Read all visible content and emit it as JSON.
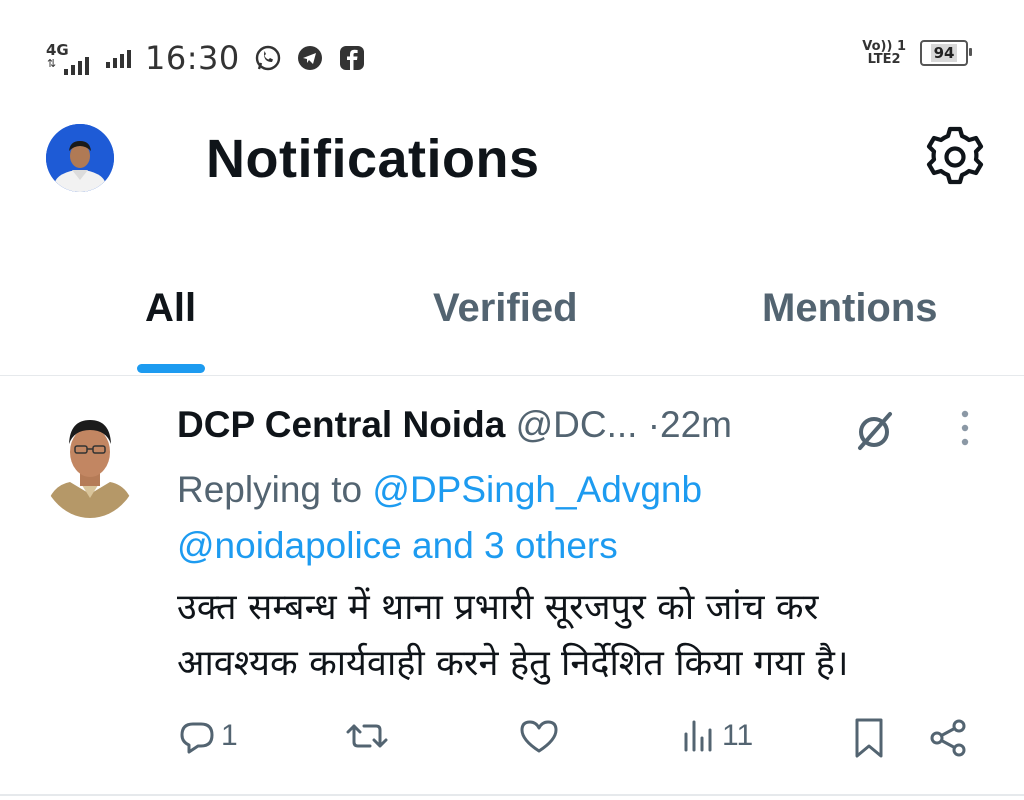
{
  "status_bar": {
    "network_type": "4G",
    "time": "16:30",
    "volte_line1": "Vo)) 1",
    "volte_line2": "LTE2",
    "battery": "94",
    "app_icons": [
      "whatsapp-icon",
      "telegram-icon",
      "facebook-icon"
    ]
  },
  "header": {
    "title": "Notifications"
  },
  "tabs": [
    {
      "label": "All",
      "active": true
    },
    {
      "label": "Verified",
      "active": false
    },
    {
      "label": "Mentions",
      "active": false
    }
  ],
  "tweet": {
    "name": "DCP Central Noida",
    "handle": "@DC...",
    "separator": "·",
    "time": "22m",
    "replying_prefix": "Replying to",
    "replying_user": "@DPSingh_Advgnb",
    "replying_rest": "@noidapolice and 3 others",
    "text_line1": "उक्त सम्बन्ध में थाना प्रभारी सूरजपुर को जांच कर",
    "text_line2": "आवश्यक कार्यवाही करने हेतु निर्देशित किया गया है।",
    "replies": "1",
    "views": "11"
  },
  "colors": {
    "accent": "#1d9bf0",
    "secondary_text": "#536471",
    "primary_text": "#0f1419"
  }
}
